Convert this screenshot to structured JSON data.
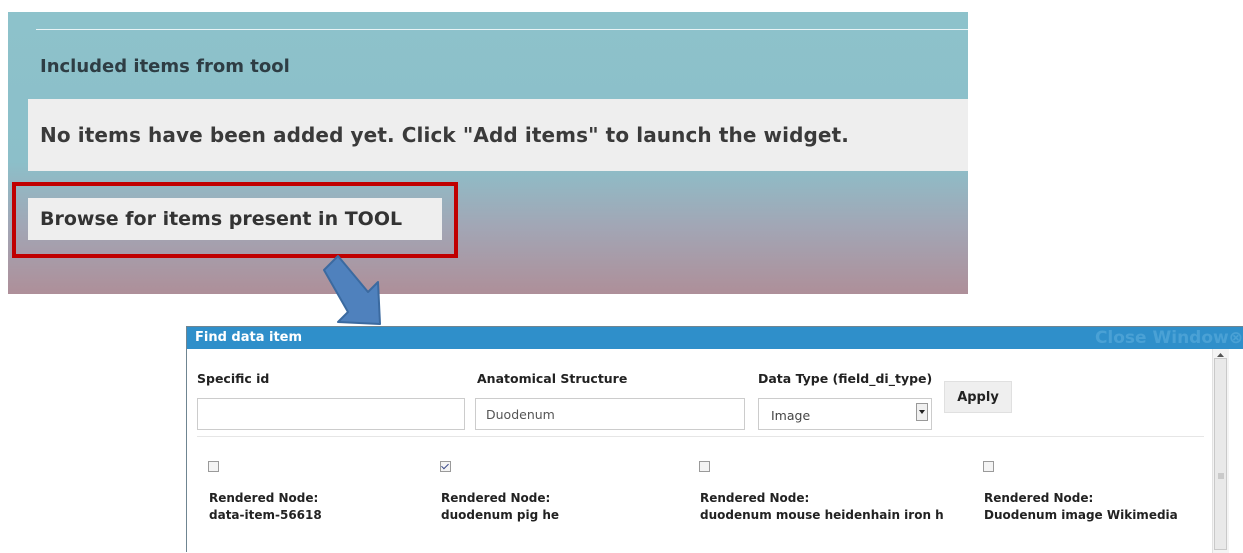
{
  "panel": {
    "heading": "Included items from tool",
    "notice": "No items have been added yet. Click \"Add items\" to launch the widget.",
    "browse_button": "Browse for items present in TOOL"
  },
  "annotation": {
    "highlight_color": "#c00000",
    "arrow_color": "#4f81bd",
    "arrow_icon": "arrow-down-right-icon"
  },
  "modal": {
    "title": "Find data item",
    "close_label": "Close Window",
    "filters": {
      "specific_id": {
        "label": "Specific id",
        "value": ""
      },
      "anatomical_structure": {
        "label": "Anatomical Structure",
        "value": "Duodenum"
      },
      "data_type": {
        "label": "Data Type (field_di_type)",
        "value": "Image"
      }
    },
    "apply_label": "Apply",
    "results": [
      {
        "checked": false,
        "label": "Rendered Node:",
        "value": "data-item-56618"
      },
      {
        "checked": true,
        "label": "Rendered Node:",
        "value": "duodenum pig he"
      },
      {
        "checked": false,
        "label": "Rendered Node:",
        "value": "duodenum mouse heidenhain iron h"
      },
      {
        "checked": false,
        "label": "Rendered Node:",
        "value": "Duodenum image Wikimedia"
      }
    ],
    "titlebar_color": "#2f8fca"
  }
}
